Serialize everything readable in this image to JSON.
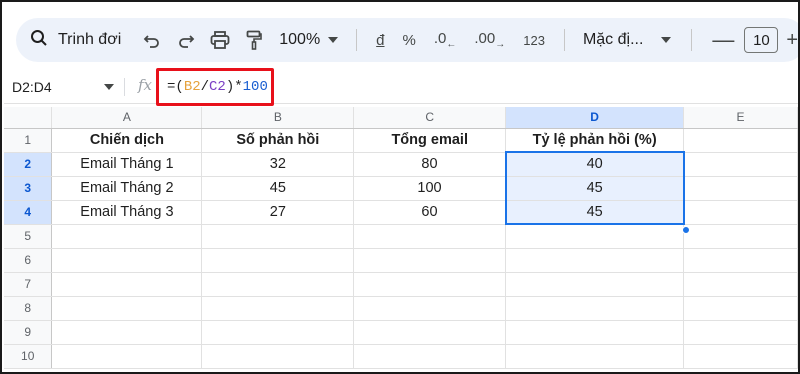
{
  "toolbar": {
    "search_label": "Trinh đơi",
    "zoom": "100%",
    "currency": "đ",
    "percent": "%",
    "dec_decrease": ".0",
    "dec_increase": ".00",
    "number_format": "123",
    "font": "Mặc đị...",
    "minus": "—",
    "font_size": "10",
    "plus": "+"
  },
  "formula_bar": {
    "name_box": "D2:D4",
    "fx": "fx",
    "formula_parts": [
      "=(",
      "B2",
      "/",
      "C2",
      ")*",
      "100"
    ]
  },
  "columns": [
    "A",
    "B",
    "C",
    "D",
    "E"
  ],
  "rows": [
    "1",
    "2",
    "3",
    "4",
    "5",
    "6",
    "7",
    "8",
    "9",
    "10"
  ],
  "headers": [
    "Chiến dịch",
    "Số phản hồi",
    "Tổng email",
    "Tỷ lệ phản hồi (%)"
  ],
  "data_rows": [
    [
      "Email Tháng 1",
      "32",
      "80",
      "40"
    ],
    [
      "Email Tháng 2",
      "45",
      "100",
      "45"
    ],
    [
      "Email Tháng 3",
      "27",
      "60",
      "45"
    ]
  ],
  "colors": {
    "selection": "#1a73e8",
    "selection_fill": "#e8f0fe",
    "formula_highlight": "#e8101a"
  }
}
